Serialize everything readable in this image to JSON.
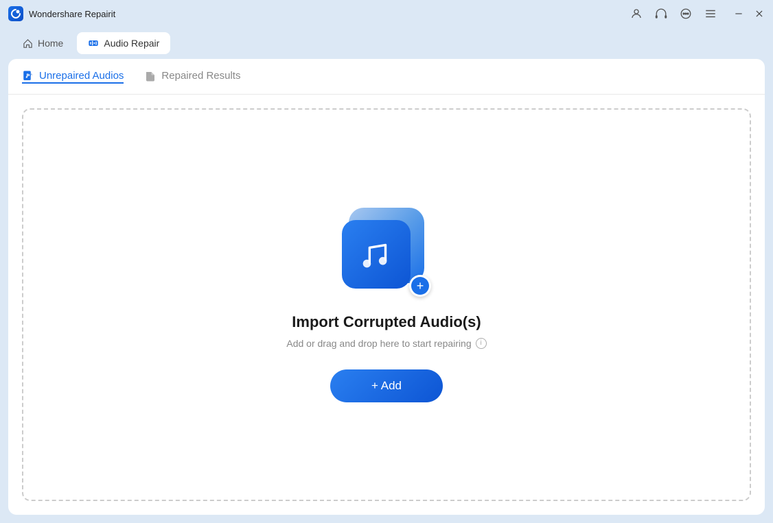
{
  "app": {
    "title": "Wondershare Repairit",
    "icon": "repairit-icon"
  },
  "titlebar": {
    "icons": {
      "user": "person-icon",
      "headset": "headset-icon",
      "chat": "chat-icon",
      "menu": "menu-icon",
      "minimize": "minimize-icon",
      "close": "close-icon"
    }
  },
  "navbar": {
    "home_label": "Home",
    "audio_repair_label": "Audio Repair"
  },
  "tabs": {
    "unrepaired_label": "Unrepaired Audios",
    "repaired_label": "Repaired Results"
  },
  "dropzone": {
    "title": "Import Corrupted Audio(s)",
    "subtitle": "Add or drag and drop here to start repairing",
    "add_button": "+ Add"
  }
}
